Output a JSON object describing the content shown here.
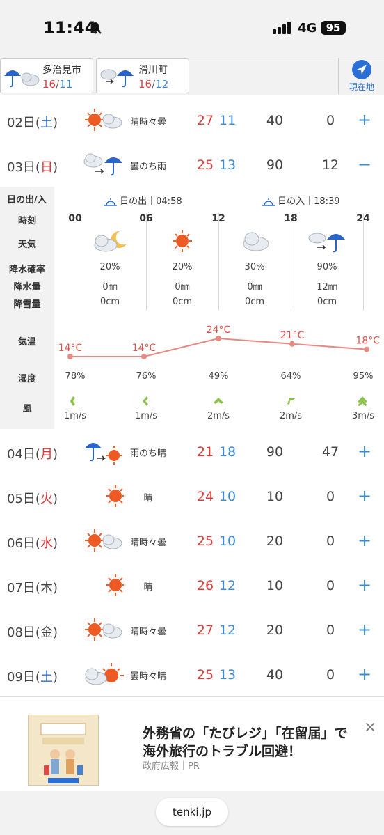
{
  "status": {
    "time": "11:44",
    "network": "4G",
    "battery": "95"
  },
  "locations": [
    {
      "name": "多治見市",
      "high": "16",
      "low": "11"
    },
    {
      "name": "滑川町",
      "high": "16",
      "low": "12"
    }
  ],
  "here_label": "現在地",
  "days": [
    {
      "day": "02日",
      "wd": "土",
      "weather": "晴時々曇",
      "high": "27",
      "low": "11",
      "pop": "40",
      "rain": "0",
      "toggle": "+"
    },
    {
      "day": "03日",
      "wd": "日",
      "weather": "曇のち雨",
      "high": "25",
      "low": "13",
      "pop": "90",
      "rain": "12",
      "toggle": "−"
    },
    {
      "day": "04日",
      "wd": "月",
      "weather": "雨のち晴",
      "high": "21",
      "low": "18",
      "pop": "90",
      "rain": "47",
      "toggle": "+"
    },
    {
      "day": "05日",
      "wd": "火",
      "weather": "晴",
      "high": "24",
      "low": "10",
      "pop": "10",
      "rain": "0",
      "toggle": "+"
    },
    {
      "day": "06日",
      "wd": "水",
      "weather": "晴時々曇",
      "high": "25",
      "low": "10",
      "pop": "20",
      "rain": "0",
      "toggle": "+"
    },
    {
      "day": "07日",
      "wd": "木",
      "weather": "晴",
      "high": "26",
      "low": "12",
      "pop": "10",
      "rain": "0",
      "toggle": "+"
    },
    {
      "day": "08日",
      "wd": "金",
      "weather": "晴時々曇",
      "high": "27",
      "low": "12",
      "pop": "20",
      "rain": "0",
      "toggle": "+"
    },
    {
      "day": "09日",
      "wd": "土",
      "weather": "曇時々晴",
      "high": "25",
      "low": "13",
      "pop": "40",
      "rain": "0",
      "toggle": "+"
    }
  ],
  "detail": {
    "labels": {
      "sun": "日の出/入",
      "time": "時刻",
      "weather": "天気",
      "pop": "降水確率",
      "rain": "降水量",
      "snow": "降雪量",
      "temp": "気温",
      "humidity": "湿度",
      "wind": "風"
    },
    "sunrise": "日の出｜04:58",
    "sunset": "日の入｜18:39",
    "hours": [
      "00",
      "06",
      "12",
      "18",
      "24"
    ],
    "pop": [
      "20%",
      "20%",
      "30%",
      "90%"
    ],
    "rain": [
      "0㎜",
      "0㎜",
      "0㎜",
      "12㎜"
    ],
    "snow": [
      "0cm",
      "0cm",
      "0cm",
      "0cm"
    ],
    "temps": [
      "14°C",
      "14°C",
      "24°C",
      "21°C",
      "18°C"
    ],
    "humidity": [
      "78%",
      "76%",
      "49%",
      "64%",
      "95%"
    ],
    "wind": [
      "1m/s",
      "1m/s",
      "2m/s",
      "2m/s",
      "3m/s"
    ]
  },
  "ad": {
    "title": "外務省の「たびレジ」「在留届」で海外旅行のトラブル回避！",
    "source": "政府広報｜PR",
    "close": "×"
  },
  "footer": {
    "site": "tenki.jp"
  }
}
